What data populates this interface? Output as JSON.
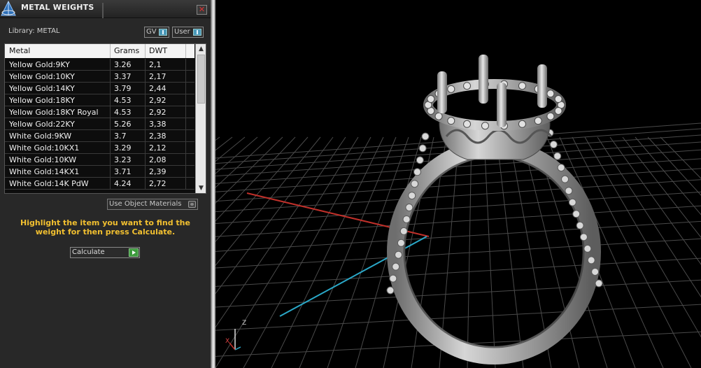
{
  "panel": {
    "title": "METAL WEIGHTS",
    "close_label": "✕",
    "library_label": "Library: METAL",
    "scope_buttons": [
      {
        "label": "GV"
      },
      {
        "label": "User"
      }
    ],
    "use_object_materials": "Use Object Materials",
    "hint": "Highlight the item you want to find the weight for then press Calculate.",
    "calculate_label": "Calculate"
  },
  "table": {
    "columns": [
      "Metal",
      "Grams",
      "DWT"
    ],
    "rows": [
      {
        "metal": "Yellow Gold:9KY",
        "grams": "3.26",
        "dwt": "2,1"
      },
      {
        "metal": "Yellow Gold:10KY",
        "grams": "3.37",
        "dwt": "2,17"
      },
      {
        "metal": "Yellow Gold:14KY",
        "grams": "3.79",
        "dwt": "2,44"
      },
      {
        "metal": "Yellow Gold:18KY",
        "grams": "4.53",
        "dwt": "2,92"
      },
      {
        "metal": "Yellow Gold:18KY Royal",
        "grams": "4.53",
        "dwt": "2,92"
      },
      {
        "metal": "Yellow Gold:22KY",
        "grams": "5.26",
        "dwt": "3,38"
      },
      {
        "metal": "White Gold:9KW",
        "grams": "3.7",
        "dwt": "2,38"
      },
      {
        "metal": "White Gold:10KX1",
        "grams": "3.29",
        "dwt": "2,12"
      },
      {
        "metal": "White Gold:10KW",
        "grams": "3.23",
        "dwt": "2,08"
      },
      {
        "metal": "White Gold:14KX1",
        "grams": "3.71",
        "dwt": "2,39"
      },
      {
        "metal": "White Gold:14K PdW",
        "grams": "4.24",
        "dwt": "2,72"
      }
    ]
  },
  "viewport": {
    "axis_labels": {
      "z": "Z",
      "x": "X"
    },
    "colors": {
      "x_axis": "#c0302a",
      "y_axis": "#2aa8c8",
      "grid": "#4a4a4a",
      "ring": "#bdbdbd"
    }
  }
}
